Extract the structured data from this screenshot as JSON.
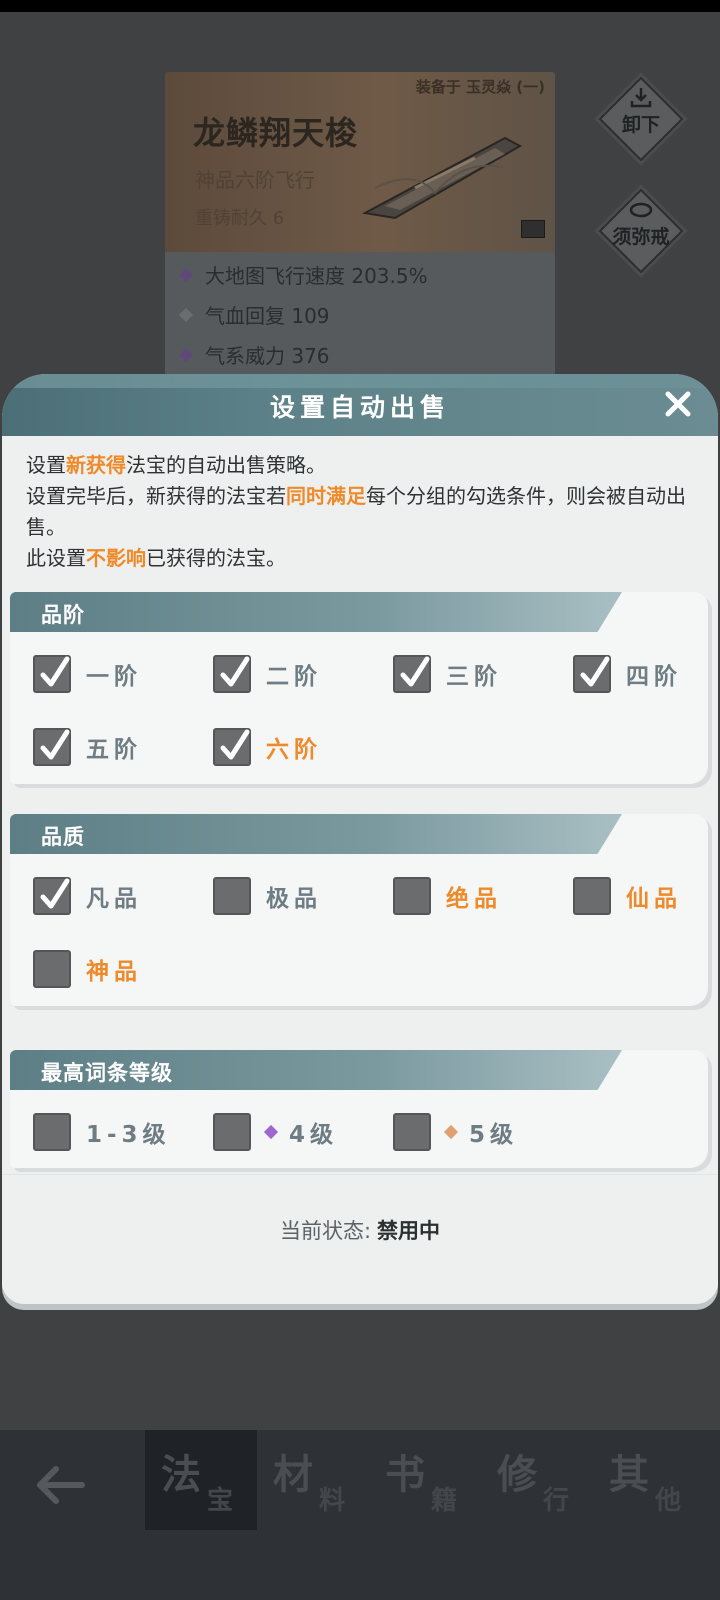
{
  "background": {
    "item_card": {
      "equipped_label": "装备于 玉灵焱 (一)",
      "name": "龙鳞翔天梭",
      "grade": "神品六阶飞行",
      "durability": "重铸耐久 6",
      "stats": [
        {
          "text": "大地图飞行速度 203.5%",
          "color": "#8a6bb0"
        },
        {
          "text": "气血回复 109",
          "color": "#7a7d80"
        },
        {
          "text": "气系威力 376",
          "color": "#8a6bb0"
        }
      ]
    },
    "side_buttons": {
      "unequip": "卸下",
      "ring": "须弥戒"
    },
    "bottom_nav": {
      "tabs": [
        {
          "big": "法",
          "small": "宝"
        },
        {
          "big": "材",
          "small": "料"
        },
        {
          "big": "书",
          "small": "籍"
        },
        {
          "big": "修",
          "small": "行"
        },
        {
          "big": "其",
          "small": "他"
        }
      ]
    }
  },
  "dialog": {
    "title": "设置自动出售",
    "description": {
      "line1_a": "设置",
      "line1_hl": "新获得",
      "line1_b": "法宝的自动出售策略。",
      "line2_a": "设置完毕后，新获得的法宝若",
      "line2_hl": "同时满足",
      "line2_b": "每个分组的勾选条件，则会被自动出售。",
      "line3_a": "此设置",
      "line3_hl": "不影响",
      "line3_b": "已获得的法宝。"
    },
    "groups": {
      "tier": {
        "title": "品阶",
        "options": [
          {
            "label": "一阶",
            "checked": true
          },
          {
            "label": "二阶",
            "checked": true
          },
          {
            "label": "三阶",
            "checked": true
          },
          {
            "label": "四阶",
            "checked": true
          },
          {
            "label": "五阶",
            "checked": true
          },
          {
            "label": "六阶",
            "checked": true
          }
        ]
      },
      "quality": {
        "title": "品质",
        "options": [
          {
            "label": "凡品",
            "checked": true
          },
          {
            "label": "极品",
            "checked": false
          },
          {
            "label": "绝品",
            "checked": false
          },
          {
            "label": "仙品",
            "checked": false
          },
          {
            "label": "神品",
            "checked": false
          }
        ]
      },
      "affix": {
        "title": "最高词条等级",
        "options": [
          {
            "label": "1-3级",
            "checked": false
          },
          {
            "label": "4级",
            "checked": false,
            "gem_color": "#a066d0"
          },
          {
            "label": "5级",
            "checked": false,
            "gem_color": "#e0a070"
          }
        ]
      }
    },
    "status": {
      "label": "当前状态:",
      "value": "禁用中"
    }
  },
  "colors": {
    "accent_orange": "#ee8a2a",
    "header_teal": "#5e8289",
    "checkbox_gray": "#6a6c6e"
  }
}
